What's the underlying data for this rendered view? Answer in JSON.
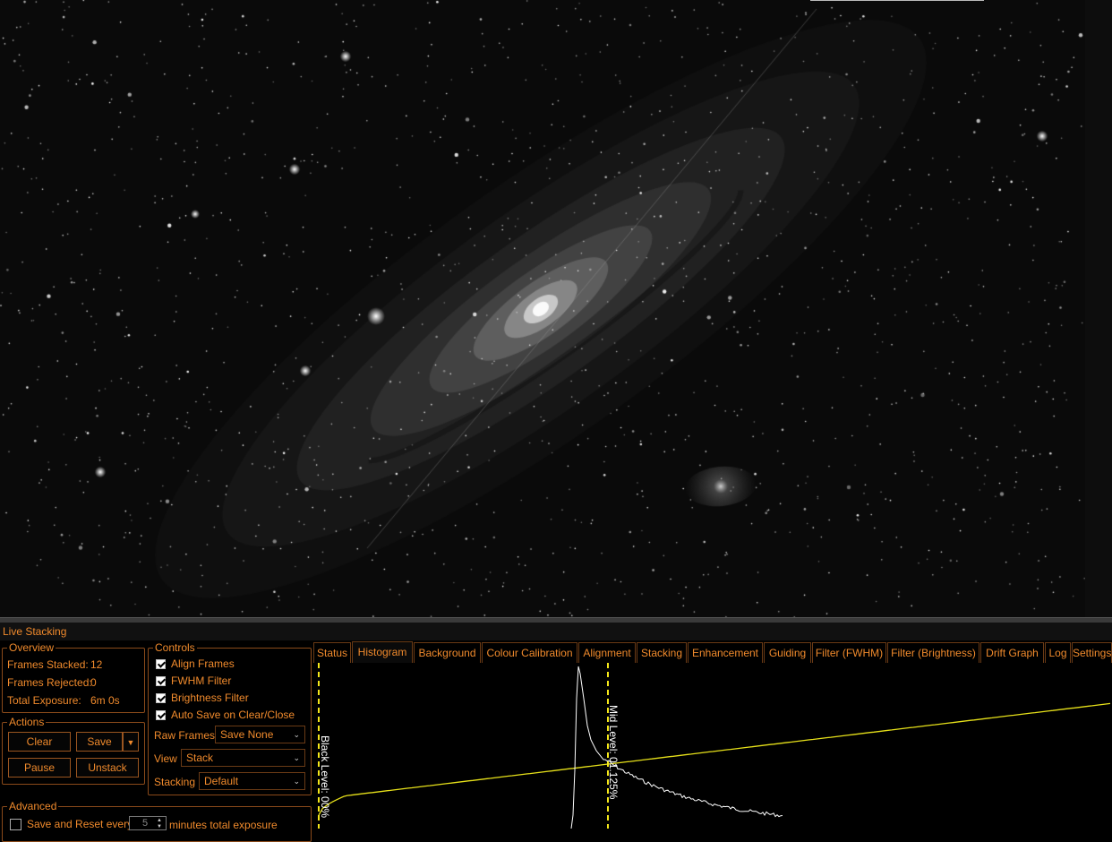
{
  "panel": {
    "title": "Live Stacking"
  },
  "overview": {
    "title": "Overview",
    "frames_stacked_label": "Frames Stacked:",
    "frames_stacked_value": "12",
    "frames_rejected_label": "Frames Rejected:",
    "frames_rejected_value": "0",
    "total_exposure_label": "Total Exposure:",
    "total_exposure_value": "6m 0s"
  },
  "actions": {
    "title": "Actions",
    "clear": "Clear",
    "save": "Save",
    "pause": "Pause",
    "unstack": "Unstack"
  },
  "controls": {
    "title": "Controls",
    "align_frames": "Align Frames",
    "fwhm_filter": "FWHM Filter",
    "brightness_filter": "Brightness Filter",
    "auto_save": "Auto Save on Clear/Close",
    "raw_frames_label": "Raw Frames",
    "raw_frames_value": "Save None",
    "view_label": "View",
    "view_value": "Stack",
    "stacking_label": "Stacking",
    "stacking_value": "Default"
  },
  "advanced": {
    "title": "Advanced",
    "save_reset_label": "Save and Reset every",
    "save_reset_value": "5",
    "save_reset_suffix": "minutes total exposure"
  },
  "tabs": [
    "Status",
    "Histogram",
    "Background",
    "Colour Calibration",
    "Alignment",
    "Stacking",
    "Enhancement",
    "Guiding",
    "Filter (FWHM)",
    "Filter (Brightness)",
    "Drift Graph",
    "Log",
    "Settings"
  ],
  "active_tab": "Histogram",
  "histogram": {
    "black_level_label": "Black Level: 00%",
    "mid_level_label": "Mid Level: 01.125%",
    "colors": {
      "curve": "#e6e01a",
      "marker": "#f5e81a",
      "histogram": "#ffffff"
    }
  },
  "accent_color": "#f08a2c"
}
